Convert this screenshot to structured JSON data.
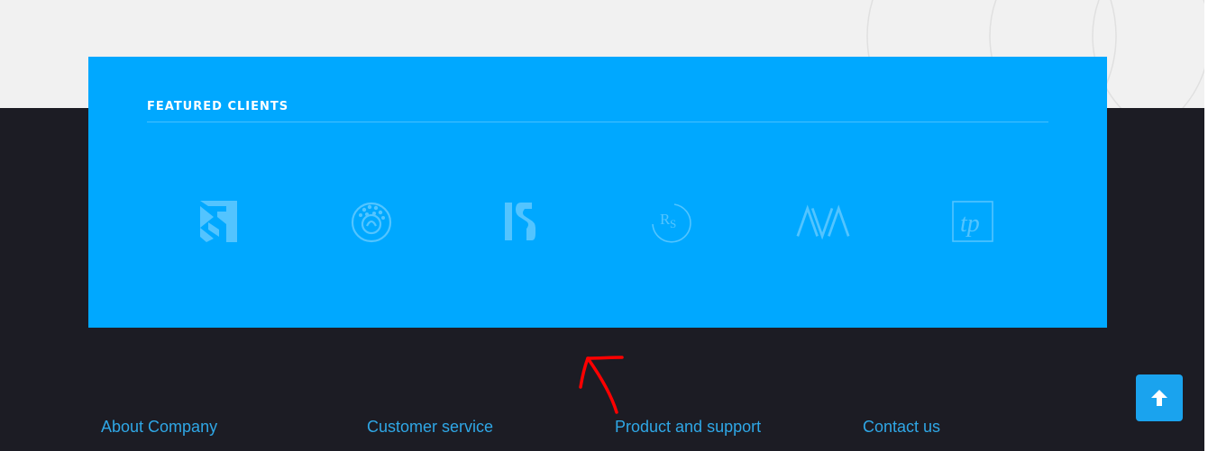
{
  "colors": {
    "accent": "#00a8ff",
    "dark_background": "#1c1c24",
    "light_background": "#f1f1f1",
    "footer_link": "#2fa7e6",
    "annotation": "#ff0000",
    "scroll_button": "#1aa3ee"
  },
  "clients": {
    "title": "FEATURED CLIENTS",
    "logos": [
      {
        "icon": "client-logo-k-icon"
      },
      {
        "icon": "client-logo-tree-icon"
      },
      {
        "icon": "client-logo-is-icon"
      },
      {
        "icon": "client-logo-rs-icon"
      },
      {
        "icon": "client-logo-ava-icon"
      },
      {
        "icon": "client-logo-tp-icon"
      }
    ]
  },
  "annotation": {
    "icon": "red-arrow-icon"
  },
  "footer": {
    "columns": [
      {
        "label": "About Company"
      },
      {
        "label": "Customer service"
      },
      {
        "label": "Product and support"
      },
      {
        "label": "Contact us"
      }
    ]
  },
  "scroll_top": {
    "icon": "arrow-up-icon"
  }
}
